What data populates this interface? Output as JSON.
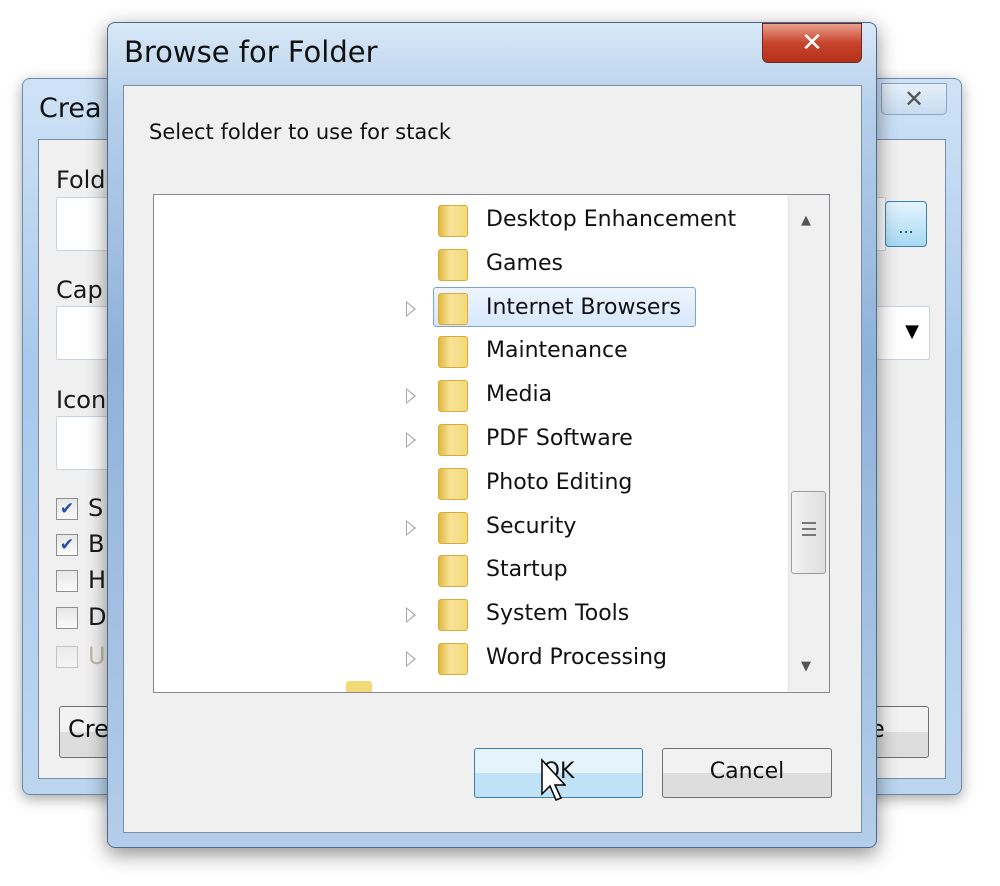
{
  "background_window": {
    "title": "Crea",
    "close_icon": "close-icon",
    "folder_label": "Fold",
    "caption_label": "Cap",
    "icon_label": "Icon",
    "browse_label": "...",
    "checkboxes": [
      {
        "label": "S",
        "checked": true
      },
      {
        "label": "B",
        "checked": true
      },
      {
        "label": "H",
        "checked": false
      },
      {
        "label": "D",
        "checked": false
      },
      {
        "label": "U",
        "checked": false,
        "disabled": true
      }
    ],
    "create_button": "Crea",
    "right_button": "e"
  },
  "dialog": {
    "title": "Browse for Folder",
    "close_label": "X",
    "prompt": "Select folder to use for stack",
    "tree": [
      {
        "label": "Desktop Enhancement",
        "expandable": false
      },
      {
        "label": "Games",
        "expandable": false
      },
      {
        "label": "Internet Browsers",
        "expandable": true,
        "selected": true
      },
      {
        "label": "Maintenance",
        "expandable": false
      },
      {
        "label": "Media",
        "expandable": true
      },
      {
        "label": "PDF Software",
        "expandable": true
      },
      {
        "label": "Photo Editing",
        "expandable": false
      },
      {
        "label": "Security",
        "expandable": true
      },
      {
        "label": "Startup",
        "expandable": false
      },
      {
        "label": "System Tools",
        "expandable": true
      },
      {
        "label": "Word Processing",
        "expandable": true
      }
    ],
    "ok_label": "OK",
    "cancel_label": "Cancel"
  },
  "colors": {
    "selection": "#d6e8fb",
    "close_red": "#c8452d",
    "ok_blue": "#bfe2f7"
  }
}
